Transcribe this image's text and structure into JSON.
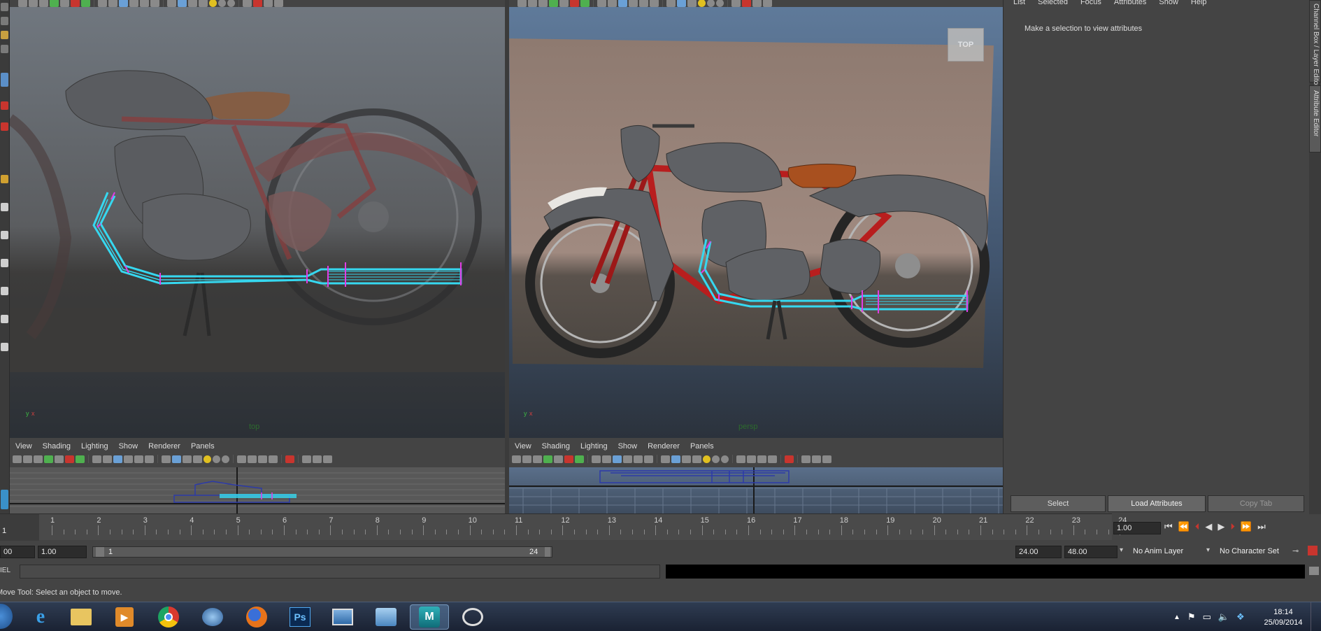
{
  "left_view": {
    "menus": [
      "View",
      "Shading",
      "Lighting",
      "Show",
      "Renderer",
      "Panels"
    ],
    "axis_y": "y",
    "axis_x": "x",
    "camera_label": "top"
  },
  "right_view": {
    "menus": [
      "View",
      "Shading",
      "Lighting",
      "Show",
      "Renderer",
      "Panels"
    ],
    "axis_y": "y",
    "axis_x": "x",
    "camera_label": "persp",
    "viewcube_label": "TOP"
  },
  "bottom_left_view": {
    "menus": [
      "View",
      "Shading",
      "Lighting",
      "Show",
      "Renderer",
      "Panels"
    ]
  },
  "bottom_right_view": {
    "menus": [
      "View",
      "Shading",
      "Lighting",
      "Show",
      "Renderer",
      "Panels"
    ]
  },
  "attribute_editor": {
    "menus": [
      "List",
      "Selected",
      "Focus",
      "Attributes",
      "Show",
      "Help"
    ],
    "message": "Make a selection to view attributes",
    "buttons": {
      "select": "Select",
      "load": "Load Attributes",
      "copy": "Copy Tab"
    },
    "side_tabs": [
      "Channel Box / Layer Editor",
      "Attribute Editor"
    ]
  },
  "timeline": {
    "ticks": [
      "1",
      "2",
      "3",
      "4",
      "5",
      "6",
      "7",
      "8",
      "9",
      "10",
      "11",
      "12",
      "13",
      "14",
      "15",
      "16",
      "17",
      "18",
      "19",
      "20",
      "21",
      "22",
      "23",
      "24"
    ],
    "current_frame": "1",
    "current_time_field": "1.00"
  },
  "range": {
    "start_field": "00",
    "start_value": "1.00",
    "slider_start": "1",
    "slider_end": "24",
    "end_field": "24.00",
    "max_field": "48.00",
    "anim_layer": "No Anim Layer",
    "character_set": "No Character Set"
  },
  "command_line": {
    "label": "IEL",
    "input": ""
  },
  "help_line": "Move Tool: Select an object to move.",
  "taskbar": {
    "apps": [
      "start-button",
      "internet-explorer",
      "file-explorer",
      "media-player",
      "chrome",
      "thunderbird",
      "firefox",
      "photoshop",
      "image-viewer",
      "control-panel",
      "maya",
      "app"
    ],
    "clock_time": "18:14",
    "clock_date": "25/09/2014"
  },
  "colors": {
    "maya_bg": "#444444",
    "curve_cyan": "#36d8f0",
    "curve_magenta": "#e23ce6",
    "model_grey": "#5f6165",
    "frame_red": "#b81e1e",
    "seat_brown": "#a8501f"
  }
}
